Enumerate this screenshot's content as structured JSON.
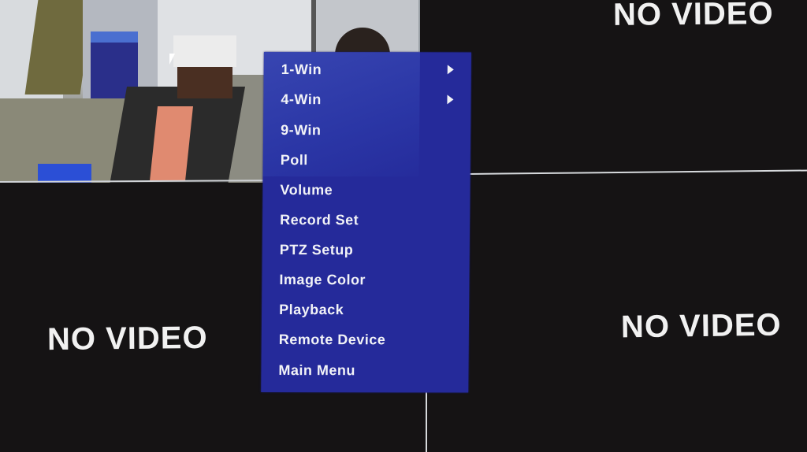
{
  "channels": [
    {
      "id": "ch1",
      "state": "live-feed"
    },
    {
      "id": "ch2",
      "state": "no-signal",
      "label": "NO VIDEO"
    },
    {
      "id": "ch3",
      "state": "no-signal",
      "label": "NO VIDEO"
    },
    {
      "id": "ch4",
      "state": "no-signal",
      "label": "NO VIDEO"
    }
  ],
  "context_menu": {
    "background_color": "#252a9a",
    "text_color": "#f2f3f7",
    "items": [
      {
        "label": "1-Win",
        "submenu": true,
        "icon": "chevron-right-icon"
      },
      {
        "label": "4-Win",
        "submenu": true,
        "icon": "chevron-right-icon"
      },
      {
        "label": "9-Win",
        "submenu": false
      },
      {
        "label": "Poll",
        "submenu": false
      },
      {
        "label": "Volume",
        "submenu": false
      },
      {
        "label": "Record Set",
        "submenu": false
      },
      {
        "label": "PTZ Setup",
        "submenu": false
      },
      {
        "label": "Image Color",
        "submenu": false
      },
      {
        "label": "Playback",
        "submenu": false
      },
      {
        "label": "Remote Device",
        "submenu": false
      },
      {
        "label": "Main Menu",
        "submenu": false
      }
    ]
  }
}
